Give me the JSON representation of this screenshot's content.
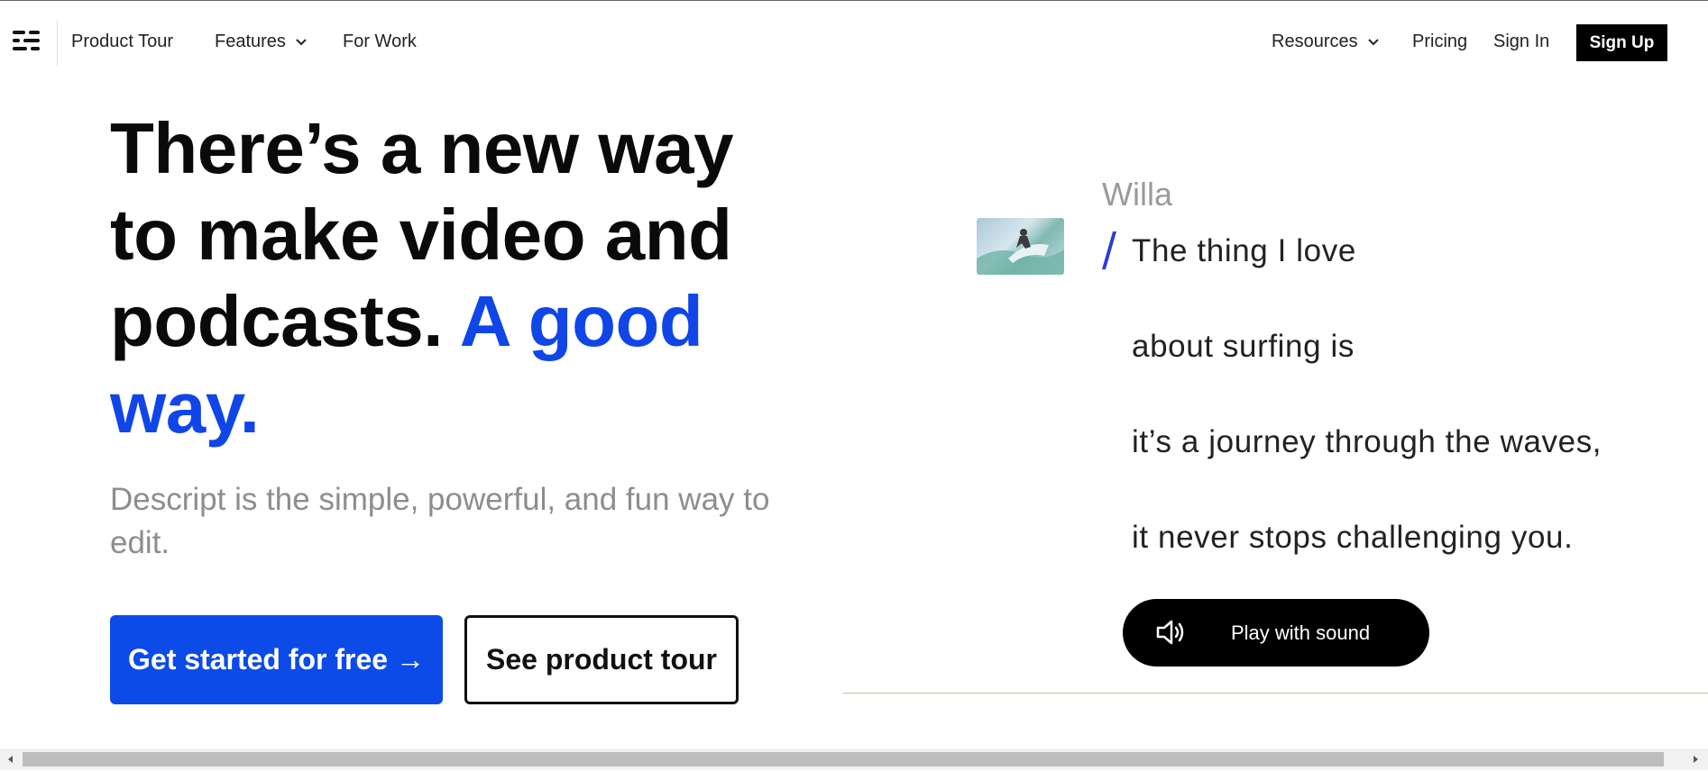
{
  "nav": {
    "left_items": [
      {
        "label": "Product Tour",
        "has_dropdown": false
      },
      {
        "label": "Features",
        "has_dropdown": true
      },
      {
        "label": "For Work",
        "has_dropdown": false
      }
    ],
    "right_items": [
      {
        "label": "Resources",
        "has_dropdown": true
      },
      {
        "label": "Pricing",
        "has_dropdown": false
      },
      {
        "label": "Sign In",
        "has_dropdown": false
      }
    ],
    "signup_label": "Sign Up"
  },
  "hero": {
    "headline_main": "There’s a new way to make video and podcasts.",
    "headline_accent": "A good way.",
    "subhead": "Descript is the simple, powerful, and fun way to edit.",
    "cta_primary": "Get started for free →",
    "cta_secondary": "See product tour"
  },
  "demo": {
    "speaker": "Willa",
    "lines": [
      "The thing I love",
      "about surfing is",
      "it’s a journey through the waves,",
      "it never stops challenging you."
    ],
    "play_label": "Play with sound"
  },
  "colors": {
    "accent_blue": "#0c4be8",
    "black": "#000000",
    "muted_gray": "#8d8d8d"
  },
  "icons": {
    "logo": "descript-logo-icon",
    "dropdown": "chevron-down-icon",
    "speaker": "speaker-icon"
  }
}
